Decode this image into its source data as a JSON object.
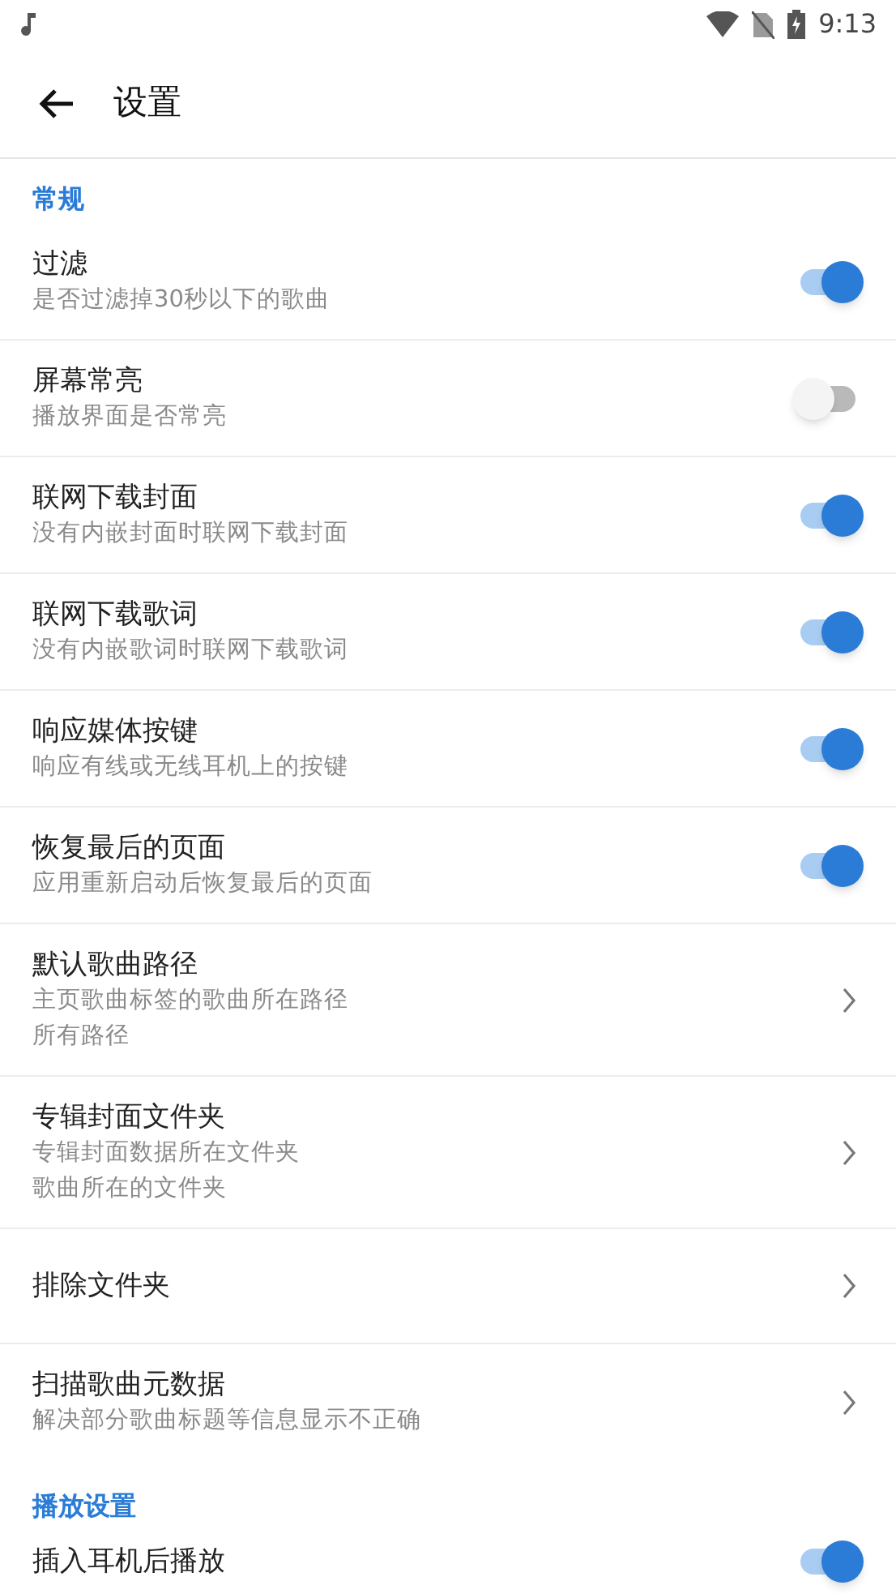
{
  "status_bar": {
    "time": "9:13"
  },
  "app_bar": {
    "title": "设置"
  },
  "sections": [
    {
      "header": "常规",
      "items": [
        {
          "kind": "switch",
          "title": "过滤",
          "subtitle": "是否过滤掉30秒以下的歌曲",
          "on": true
        },
        {
          "kind": "switch",
          "title": "屏幕常亮",
          "subtitle": "播放界面是否常亮",
          "on": false
        },
        {
          "kind": "switch",
          "title": "联网下载封面",
          "subtitle": "没有内嵌封面时联网下载封面",
          "on": true
        },
        {
          "kind": "switch",
          "title": "联网下载歌词",
          "subtitle": "没有内嵌歌词时联网下载歌词",
          "on": true
        },
        {
          "kind": "switch",
          "title": "响应媒体按键",
          "subtitle": "响应有线或无线耳机上的按键",
          "on": true
        },
        {
          "kind": "switch",
          "title": "恢复最后的页面",
          "subtitle": "应用重新启动后恢复最后的页面",
          "on": true
        },
        {
          "kind": "nav",
          "title": "默认歌曲路径",
          "subtitle": "主页歌曲标签的歌曲所在路径",
          "value": "所有路径"
        },
        {
          "kind": "nav",
          "title": "专辑封面文件夹",
          "subtitle": "专辑封面数据所在文件夹",
          "value": "歌曲所在的文件夹"
        },
        {
          "kind": "nav",
          "title": "排除文件夹"
        },
        {
          "kind": "nav",
          "title": "扫描歌曲元数据",
          "subtitle": "解决部分歌曲标题等信息显示不正确"
        }
      ]
    },
    {
      "header": "播放设置",
      "items": [
        {
          "kind": "switch",
          "title": "插入耳机后播放",
          "on": true
        }
      ]
    }
  ]
}
